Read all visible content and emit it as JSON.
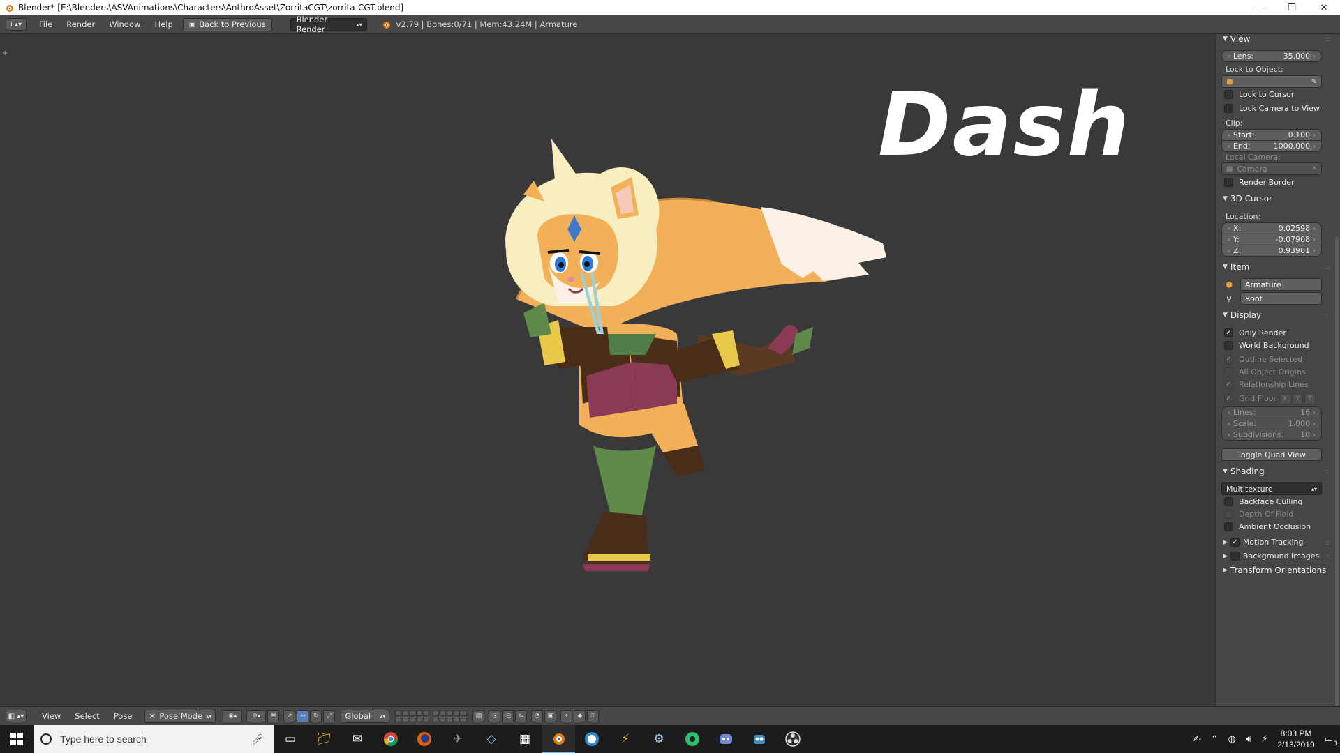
{
  "window": {
    "title": "Blender* [E:\\Blenders\\ASVAnimations\\Characters\\AnthroAsset\\ZorritaCGT\\zorrita-CGT.blend]",
    "minimize": "—",
    "maximize": "❐",
    "close": "✕"
  },
  "info_header": {
    "editor_icon": "i",
    "menus": [
      "File",
      "Render",
      "Window",
      "Help"
    ],
    "back_button": "Back to Previous",
    "render_engine": "Blender Render",
    "stats": "v2.79 | Bones:0/71 | Mem:43.24M | Armature"
  },
  "viewport": {
    "overlay_title": "Dash"
  },
  "npanel": {
    "view": {
      "header": "View",
      "lens_label": "Lens:",
      "lens_value": "35.000",
      "lock_to_object": "Lock to Object:",
      "lock_to_cursor": "Lock to Cursor",
      "lock_camera_to_view": "Lock Camera to View",
      "clip": "Clip:",
      "start_label": "Start:",
      "start_value": "0.100",
      "end_label": "End:",
      "end_value": "1000.000",
      "local_camera": "Local Camera:",
      "camera_field": "Camera",
      "render_border": "Render Border"
    },
    "cursor": {
      "header": "3D Cursor",
      "location": "Location:",
      "x_label": "X:",
      "x_value": "0.02598",
      "y_label": "Y:",
      "y_value": "-0.07908",
      "z_label": "Z:",
      "z_value": "0.93901"
    },
    "item": {
      "header": "Item",
      "object_name": "Armature",
      "bone_name": "Root"
    },
    "display": {
      "header": "Display",
      "only_render": "Only Render",
      "world_background": "World Background",
      "outline_selected": "Outline Selected",
      "all_object_origins": "All Object Origins",
      "relationship_lines": "Relationship Lines",
      "grid_floor": "Grid Floor",
      "axis_x": "X",
      "axis_y": "Y",
      "axis_z": "Z",
      "lines_label": "Lines:",
      "lines_value": "16",
      "scale_label": "Scale:",
      "scale_value": "1.000",
      "subdivisions_label": "Subdivisions:",
      "subdivisions_value": "10",
      "toggle_quad_view": "Toggle Quad View"
    },
    "shading": {
      "header": "Shading",
      "mode": "Multitexture",
      "backface_culling": "Backface Culling",
      "depth_of_field": "Depth Of Field",
      "ambient_occlusion": "Ambient Occlusion"
    },
    "motion_tracking": "Motion Tracking",
    "background_images": "Background Images",
    "transform_orientations": "Transform Orientations"
  },
  "bottom_header": {
    "menus": [
      "View",
      "Select",
      "Pose"
    ],
    "mode": "Pose Mode",
    "orientation": "Global"
  },
  "taskbar": {
    "search_placeholder": "Type here to search",
    "time": "8:03 PM",
    "date": "2/13/2019",
    "notifications": "3"
  },
  "colors": {
    "accent_blue": "#5680c2",
    "panel": "#464646",
    "viewport": "#393939",
    "fur_orange": "#f2b158",
    "hair_cream": "#f8eec0"
  }
}
